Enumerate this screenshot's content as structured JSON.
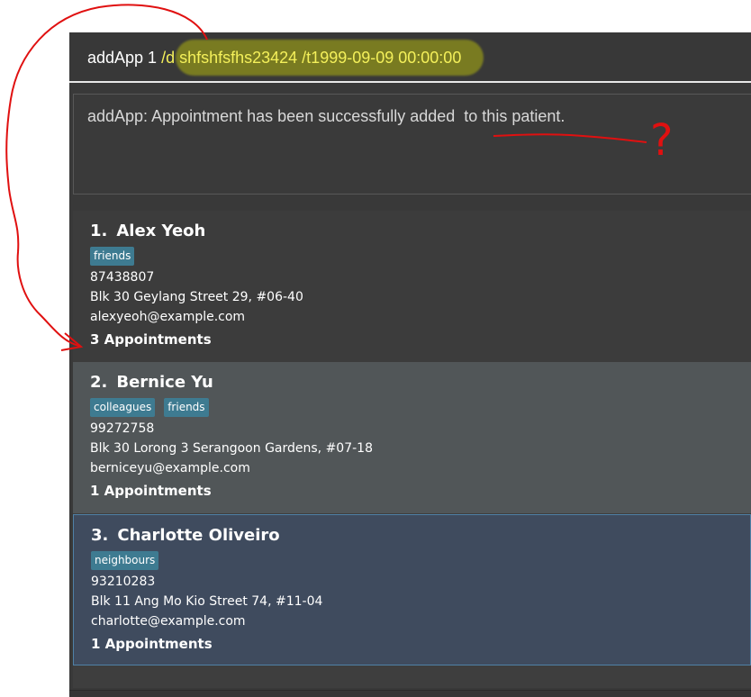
{
  "command_box": {
    "command": "addApp 1 ",
    "args": "/d shfshfsfhs23424 /t1999-09-09 00:00:00"
  },
  "result_display": {
    "text": "addApp: Appointment has been successfully added  to this patient."
  },
  "annotation": {
    "question_mark": "?"
  },
  "persons": [
    {
      "index": "1.",
      "name": "Alex Yeoh",
      "tags": [
        "friends"
      ],
      "phone": "87438807",
      "address": "Blk 30 Geylang Street 29, #06-40",
      "email": "alexyeoh@example.com",
      "appointments": "3 Appointments"
    },
    {
      "index": "2.",
      "name": "Bernice Yu",
      "tags": [
        "colleagues",
        "friends"
      ],
      "phone": "99272758",
      "address": "Blk 30 Lorong 3 Serangoon Gardens, #07-18",
      "email": "berniceyu@example.com",
      "appointments": "1 Appointments"
    },
    {
      "index": "3.",
      "name": "Charlotte Oliveiro",
      "tags": [
        "neighbours"
      ],
      "phone": "93210283",
      "address": "Blk 11 Ang Mo Kio Street 74, #11-04",
      "email": "charlotte@example.com",
      "appointments": "1 Appointments"
    }
  ],
  "colors": {
    "window_bg": "#393939",
    "tag_bg": "#3e7b91",
    "highlight": "#8f921a",
    "annotation_red": "#e01010",
    "selected_card_bg": "#3f4b5e",
    "hover_card_bg": "#515658"
  }
}
